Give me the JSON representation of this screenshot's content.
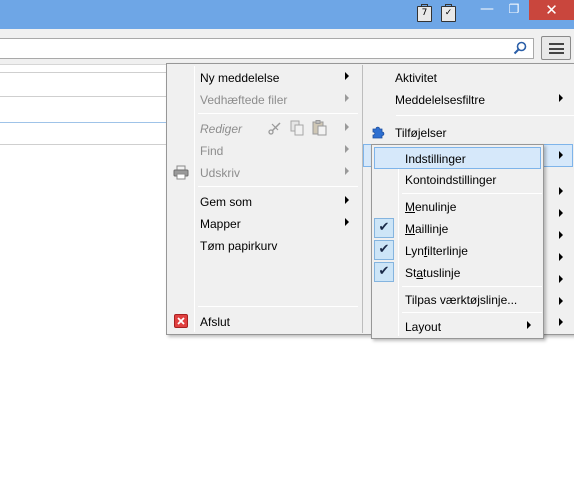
{
  "titlebar": {
    "calendar_day": "7",
    "tasks_glyph": "✓",
    "minimize": "—",
    "maximize": "❐",
    "close": "✕",
    "close_color": "#c9463d",
    "accent": "#6ea6e6"
  },
  "toolbar": {
    "search_placeholder": "",
    "search_icon": "search-icon",
    "menu_icon": "hamburger-icon"
  },
  "app_menu_left": {
    "items": [
      {
        "label": "Ny meddelelse",
        "submenu": true,
        "enabled": true
      },
      {
        "label": "Vedhæftede filer",
        "submenu": true,
        "enabled": false
      },
      {
        "label": "Rediger",
        "submenu": true,
        "enabled": false,
        "edit_icons": [
          "cut-icon",
          "copy-icon",
          "paste-icon"
        ]
      },
      {
        "label": "Find",
        "submenu": true,
        "enabled": false
      },
      {
        "label": "Udskriv",
        "submenu": true,
        "enabled": false,
        "icon": "printer-icon"
      },
      {
        "label": "Gem som",
        "submenu": true,
        "enabled": true
      },
      {
        "label": "Mapper",
        "submenu": true,
        "enabled": true
      },
      {
        "label": "Tøm papirkurv",
        "submenu": false,
        "enabled": true
      },
      {
        "label": "Afslut",
        "submenu": false,
        "enabled": true,
        "icon": "exit-icon"
      }
    ]
  },
  "app_menu_right": {
    "items": [
      {
        "label": "Aktivitet",
        "submenu": false
      },
      {
        "label": "Meddelelsesfiltre",
        "submenu": true
      },
      {
        "label": "Tilføjelser",
        "submenu": false,
        "icon": "puzzle-icon"
      }
    ]
  },
  "options_submenu": {
    "items": [
      {
        "label": "Indstillinger",
        "highlighted": true
      },
      {
        "label": "Kontoindstillinger"
      },
      {
        "label_pre": "",
        "label_u": "M",
        "label_post": "enulinje",
        "checked": false
      },
      {
        "label_pre": "",
        "label_u": "M",
        "label_post": "aillinje",
        "checked": true
      },
      {
        "label_pre": "Lyn",
        "label_u": "f",
        "label_post": "ilterlinje",
        "checked": true
      },
      {
        "label_pre": "St",
        "label_u": "a",
        "label_post": "tuslinje",
        "checked": true
      },
      {
        "label": "Tilpas værktøjslinje..."
      },
      {
        "label": "Layout",
        "submenu": true
      }
    ],
    "check_glyph": "✔"
  }
}
